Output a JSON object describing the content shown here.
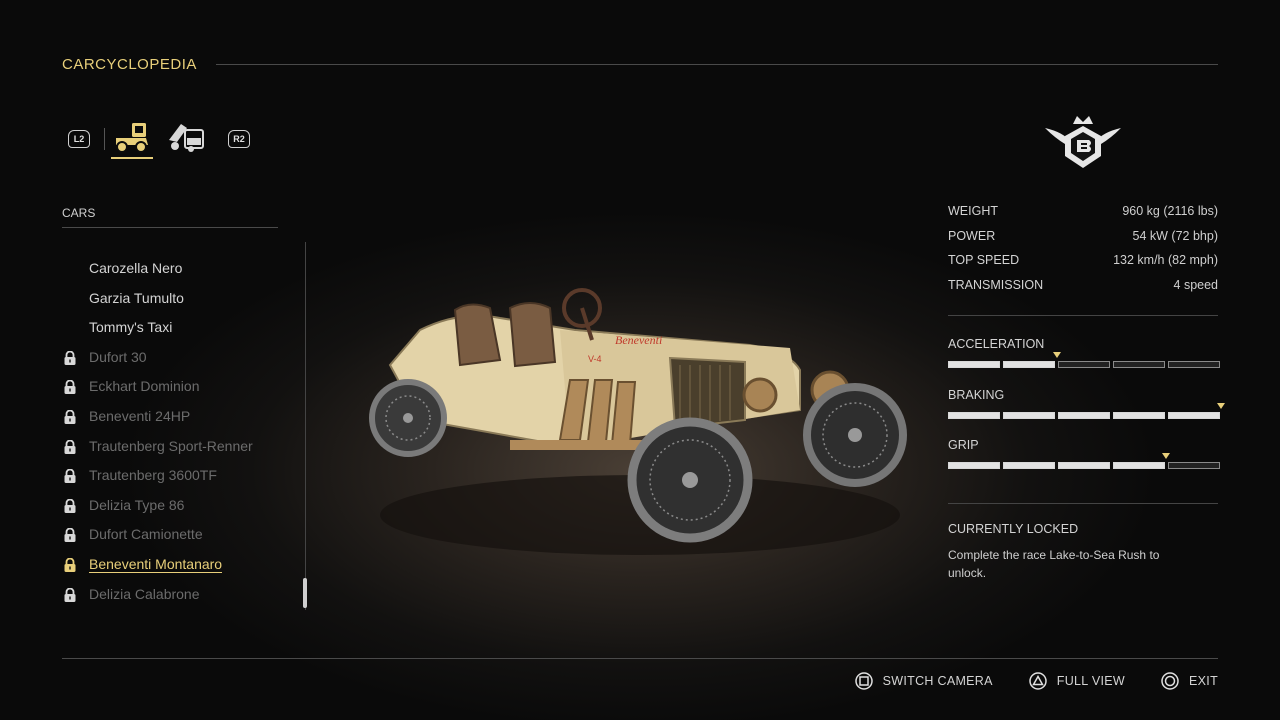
{
  "header": {
    "title": "CARCYCLOPEDIA"
  },
  "tabs": {
    "left_button": "L2",
    "right_button": "R2",
    "items": [
      {
        "icon": "car-icon",
        "active": true
      },
      {
        "icon": "car-blueprint-icon",
        "active": false
      }
    ]
  },
  "car_list": {
    "heading": "CARS",
    "items": [
      {
        "name": "Carozella Nero",
        "locked": false,
        "selected": false
      },
      {
        "name": "Garzia Tumulto",
        "locked": false,
        "selected": false
      },
      {
        "name": "Tommy's Taxi",
        "locked": false,
        "selected": false
      },
      {
        "name": "Dufort 30",
        "locked": true,
        "selected": false
      },
      {
        "name": "Eckhart Dominion",
        "locked": true,
        "selected": false
      },
      {
        "name": "Beneventi 24HP",
        "locked": true,
        "selected": false
      },
      {
        "name": "Trautenberg Sport-Renner",
        "locked": true,
        "selected": false
      },
      {
        "name": "Trautenberg 3600TF",
        "locked": true,
        "selected": false
      },
      {
        "name": "Delizia Type 86",
        "locked": true,
        "selected": false
      },
      {
        "name": "Dufort Camionette",
        "locked": true,
        "selected": false
      },
      {
        "name": "Beneventi Montanaro",
        "locked": true,
        "selected": true
      },
      {
        "name": "Delizia Calabrone",
        "locked": true,
        "selected": false
      }
    ]
  },
  "car_preview": {
    "brand_lettering": "Beneventi",
    "badge": "V-4"
  },
  "brand_logo": {
    "icon": "beneventi-crest-icon"
  },
  "specs": [
    {
      "label": "WEIGHT",
      "value": "960 kg (2116 lbs)"
    },
    {
      "label": "POWER",
      "value": "54 kW (72 bhp)"
    },
    {
      "label": "TOP SPEED",
      "value": "132 km/h (82 mph)"
    },
    {
      "label": "TRANSMISSION",
      "value": "4 speed"
    }
  ],
  "ratings": [
    {
      "label": "ACCELERATION",
      "filled_segments": 2,
      "total_segments": 5,
      "marker_fraction": 0.4
    },
    {
      "label": "BRAKING",
      "filled_segments": 5,
      "total_segments": 5,
      "marker_fraction": 1.0
    },
    {
      "label": "GRIP",
      "filled_segments": 4,
      "total_segments": 5,
      "marker_fraction": 0.8
    }
  ],
  "unlock": {
    "title": "CURRENTLY LOCKED",
    "description": "Complete the race Lake-to-Sea Rush to unlock."
  },
  "footer": {
    "actions": [
      {
        "icon": "square-button-icon",
        "label": "SWITCH CAMERA"
      },
      {
        "icon": "triangle-button-icon",
        "label": "FULL VIEW"
      },
      {
        "icon": "circle-button-icon",
        "label": "EXIT"
      }
    ]
  },
  "colors": {
    "accent": "#e8cf7a",
    "locked_text": "#6c6c6c",
    "text": "#d4d4d4"
  }
}
